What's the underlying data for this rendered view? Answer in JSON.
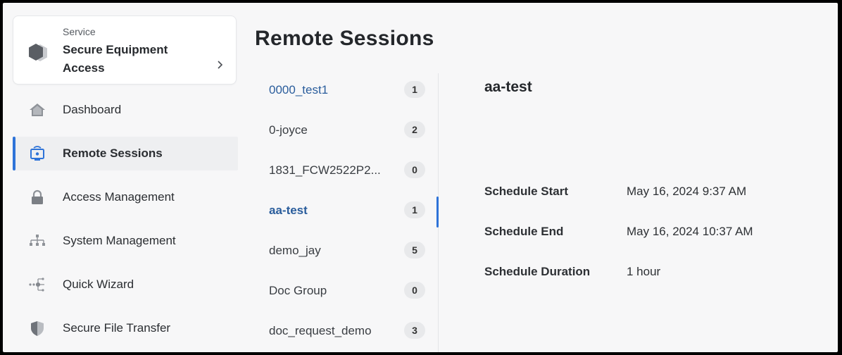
{
  "sidebar": {
    "service": {
      "label": "Service",
      "name": "Secure Equipment Access"
    },
    "items": [
      {
        "label": "Dashboard",
        "icon": "home-icon"
      },
      {
        "label": "Remote Sessions",
        "icon": "remote-session-icon",
        "active": true
      },
      {
        "label": "Access Management",
        "icon": "lock-icon"
      },
      {
        "label": "System Management",
        "icon": "hierarchy-icon"
      },
      {
        "label": "Quick Wizard",
        "icon": "wizard-flow-icon"
      },
      {
        "label": "Secure File Transfer",
        "icon": "shield-icon"
      }
    ]
  },
  "main": {
    "title": "Remote Sessions",
    "groups": [
      {
        "name": "0000_test1",
        "count": "1"
      },
      {
        "name": "0-joyce",
        "count": "2"
      },
      {
        "name": "1831_FCW2522P2...",
        "count": "0"
      },
      {
        "name": "aa-test",
        "count": "1",
        "selected": true
      },
      {
        "name": "demo_jay",
        "count": "5"
      },
      {
        "name": "Doc Group",
        "count": "0"
      },
      {
        "name": "doc_request_demo",
        "count": "3"
      }
    ],
    "detail": {
      "title": "aa-test",
      "fields": [
        {
          "key": "Schedule Start",
          "value": "May 16, 2024 9:37 AM"
        },
        {
          "key": "Schedule End",
          "value": "May 16, 2024 10:37 AM"
        },
        {
          "key": "Schedule Duration",
          "value": "1 hour"
        }
      ]
    }
  },
  "colors": {
    "accent": "#2e73d8",
    "link": "#2a5d9c",
    "background": "#f7f7f8"
  }
}
